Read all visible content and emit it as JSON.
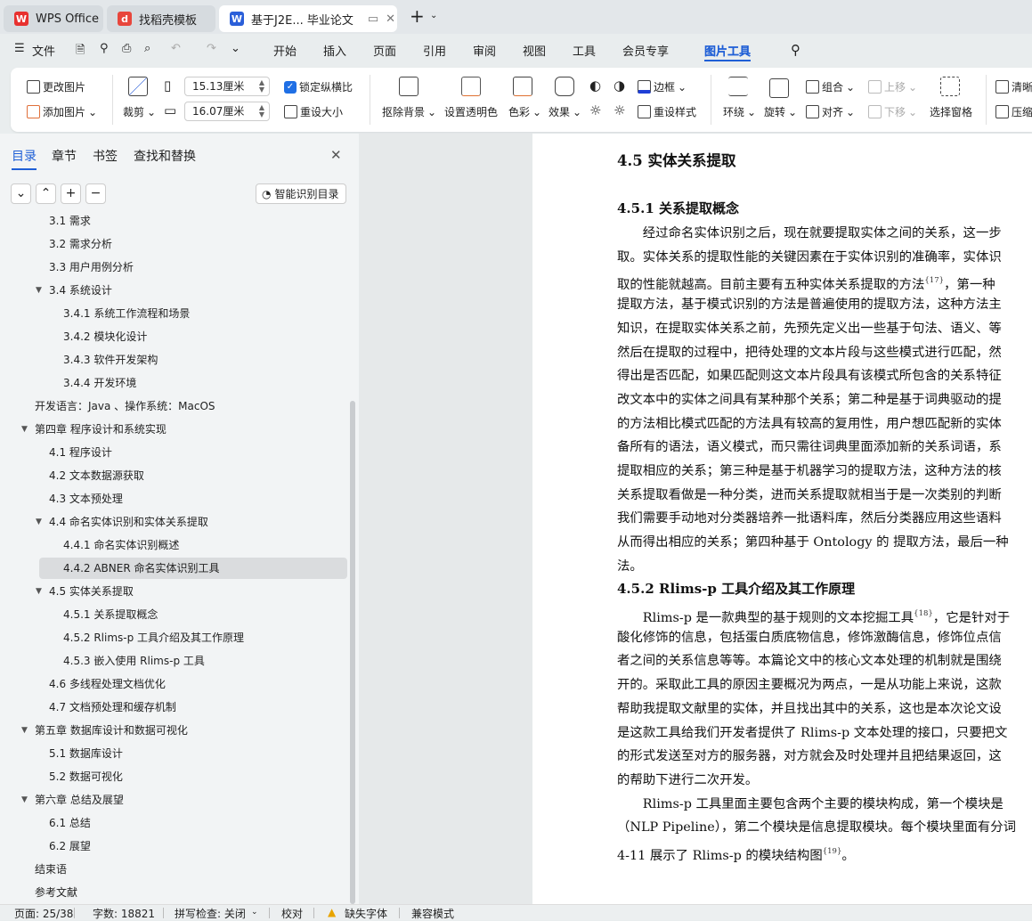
{
  "tabs": [
    {
      "label": "WPS Office",
      "icon": "wps-logo-icon"
    },
    {
      "label": "找稻壳模板",
      "icon": "docer-logo-icon"
    },
    {
      "label": "基于J2E... 毕业论文",
      "icon": "word-doc-icon"
    }
  ],
  "menu": {
    "file": "文件",
    "items": [
      "开始",
      "插入",
      "页面",
      "引用",
      "审阅",
      "视图",
      "工具",
      "会员专享",
      "图片工具"
    ],
    "active": "图片工具"
  },
  "ribbon": {
    "change_picture": "更改图片",
    "add_picture": "添加图片",
    "crop": "裁剪",
    "width": "15.13厘米",
    "height": "16.07厘米",
    "lock_ratio": "锁定纵横比",
    "lock_ratio_checked": true,
    "reset_size": "重设大小",
    "remove_bg": "抠除背景",
    "set_transparent": "设置透明色",
    "color": "色彩",
    "effects": "效果",
    "border": "边框",
    "reset_style": "重设样式",
    "wrap": "环绕",
    "rotate": "旋转",
    "group": "组合",
    "align": "对齐",
    "move_up": "上移",
    "move_down": "下移",
    "selection_pane": "选择窗格",
    "clarity": "清晰",
    "compress": "压缩",
    "accent": "#1f5fd6"
  },
  "panel": {
    "tabs": [
      "目录",
      "章节",
      "书签",
      "查找和替换"
    ],
    "smart_toc": "智能识别目录",
    "items": [
      {
        "label": "3.1 需求",
        "level": 2
      },
      {
        "label": "3.2 需求分析",
        "level": 2
      },
      {
        "label": "3.3 用户用例分析",
        "level": 2
      },
      {
        "label": "3.4 系统设计",
        "level": 2,
        "expanded": true
      },
      {
        "label": "3.4.1 系统工作流程和场景",
        "level": 3
      },
      {
        "label": "3.4.2 模块化设计",
        "level": 3
      },
      {
        "label": "3.4.3 软件开发架构",
        "level": 3
      },
      {
        "label": "3.4.4 开发环境",
        "level": 3
      },
      {
        "label": "开发语言：Java 、操作系统：MacOS",
        "level": 1
      },
      {
        "label": "第四章 程序设计和系统实现",
        "level": 1,
        "expanded": true
      },
      {
        "label": "4.1 程序设计",
        "level": 2
      },
      {
        "label": "4.2 文本数据源获取",
        "level": 2
      },
      {
        "label": "4.3 文本预处理",
        "level": 2
      },
      {
        "label": "4.4 命名实体识别和实体关系提取",
        "level": 2,
        "expanded": true
      },
      {
        "label": "4.4.1 命名实体识别概述",
        "level": 3
      },
      {
        "label": "4.4.2 ABNER 命名实体识别工具",
        "level": 3,
        "selected": true
      },
      {
        "label": "4.5 实体关系提取",
        "level": 2,
        "expanded": true
      },
      {
        "label": "4.5.1 关系提取概念",
        "level": 3
      },
      {
        "label": "4.5.2 Rlims-p 工具介绍及其工作原理",
        "level": 3
      },
      {
        "label": "4.5.3 嵌入使用 Rlims-p 工具",
        "level": 3
      },
      {
        "label": "4.6 多线程处理文档优化",
        "level": 2
      },
      {
        "label": "4.7 文档预处理和缓存机制",
        "level": 2
      },
      {
        "label": "第五章 数据库设计和数据可视化",
        "level": 1,
        "expanded": true
      },
      {
        "label": "5.1 数据库设计",
        "level": 2
      },
      {
        "label": "5.2 数据可视化",
        "level": 2
      },
      {
        "label": "第六章 总结及展望",
        "level": 1,
        "expanded": true
      },
      {
        "label": "6.1 总结",
        "level": 2
      },
      {
        "label": "6.2 展望",
        "level": 2
      },
      {
        "label": "结束语",
        "level": 1
      },
      {
        "label": "参考文献",
        "level": 1
      }
    ]
  },
  "doc": {
    "h1": "4.5  实体关系提取",
    "h2a": "4.5.1  关系提取概念",
    "para1": [
      "　　经过命名实体识别之后，现在就要提取实体之间的关系，这一步",
      "取。实体关系的提取性能的关键因素在于实体识别的准确率，实体识",
      "取的性能就越高。目前主要有五种实体关系提取的方法{17}，第一种",
      "提取方法，基于模式识别的方法是普遍使用的提取方法，这种方法主",
      "知识，在提取实体关系之前，先预先定义出一些基于句法、语义、等",
      "然后在提取的过程中，把待处理的文本片段与这些模式进行匹配，然",
      "得出是否匹配，如果匹配则这文本片段具有该模式所包含的关系特征",
      "改文本中的实体之间具有某种那个关系；第二种是基于词典驱动的提",
      "的方法相比模式匹配的方法具有较高的复用性，用户想匹配新的实体",
      "备所有的语法，语义模式，而只需往词典里面添加新的关系词语，系",
      "提取相应的关系；第三种是基于机器学习的提取方法，这种方法的核",
      "关系提取看做是一种分类，进而关系提取就相当于是一次类别的判断",
      "我们需要手动地对分类器培养一批语料库，然后分类器应用这些语料",
      "从而得出相应的关系；第四种基于 Ontology 的 提取方法，最后一种",
      "法。"
    ],
    "h2b": "4.5.2 Rlims-p 工具介绍及其工作原理",
    "para2": [
      "　　Rlims-p 是一款典型的基于规则的文本挖掘工具{18}，它是针对于",
      "酸化修饰的信息，包括蛋白质底物信息，修饰激酶信息，修饰位点信",
      "者之间的关系信息等等。本篇论文中的核心文本处理的机制就是围绕",
      "开的。采取此工具的原因主要概况为两点，一是从功能上来说，这款",
      "帮助我提取文献里的实体，并且找出其中的关系，这也是本次论文设",
      "是这款工具给我们开发者提供了 Rlims-p 文本处理的接口，只要把文",
      "的形式发送至对方的服务器，对方就会及时处理并且把结果返回，这",
      "的帮助下进行二次开发。",
      "　　Rlims-p 工具里面主要包含两个主要的模块构成，第一个模块是",
      "（NLP Pipeline），第二个模块是信息提取模块。每个模块里面有分词",
      "4-11 展示了 Rlims-p 的模块结构图{19}。"
    ]
  },
  "status": {
    "page": "页面: 25/38",
    "words": "字数: 18821",
    "spell": "拼写检查: 关闭",
    "proof": "校对",
    "missing_font": "缺失字体",
    "compat": "兼容模式"
  }
}
